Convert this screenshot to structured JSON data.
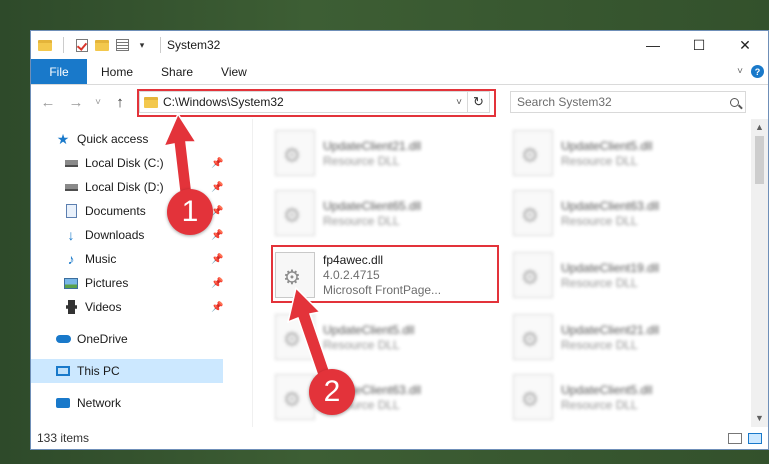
{
  "window": {
    "title": "System32",
    "controls": {
      "minimize": "—",
      "maximize": "☐",
      "close": "✕"
    }
  },
  "ribbon": {
    "file_tab": "File",
    "tabs": [
      "Home",
      "Share",
      "View"
    ]
  },
  "nav": {
    "back": "←",
    "forward": "→",
    "recent": "˅",
    "up": "↑",
    "address": "C:\\Windows\\System32",
    "search_placeholder": "Search System32"
  },
  "sidebar": {
    "items": [
      {
        "label": "Quick access",
        "icon": "star-icon"
      },
      {
        "label": "Local Disk (C:)",
        "icon": "disk-icon",
        "pinned": true
      },
      {
        "label": "Local Disk (D:)",
        "icon": "disk-icon",
        "pinned": true
      },
      {
        "label": "Documents",
        "icon": "documents-icon",
        "pinned": true
      },
      {
        "label": "Downloads",
        "icon": "downloads-icon",
        "pinned": true
      },
      {
        "label": "Music",
        "icon": "music-icon",
        "pinned": true
      },
      {
        "label": "Pictures",
        "icon": "pictures-icon",
        "pinned": true
      },
      {
        "label": "Videos",
        "icon": "videos-icon",
        "pinned": true
      },
      {
        "label": "OneDrive",
        "icon": "cloud-icon"
      },
      {
        "label": "This PC",
        "icon": "computer-icon",
        "selected": true
      },
      {
        "label": "Network",
        "icon": "network-icon"
      }
    ]
  },
  "files": [
    {
      "name": "UpdateClient21.dll",
      "sub": "Resource DLL"
    },
    {
      "name": "UpdateClient5.dll",
      "sub": "Resource DLL"
    },
    {
      "name": "UpdateClient65.dll",
      "sub": "Resource DLL"
    },
    {
      "name": "UpdateClient63.dll",
      "sub": "Resource DLL"
    },
    {
      "name": "fp4awec.dll",
      "version": "4.0.2.4715",
      "sub": "Microsoft FrontPage..."
    },
    {
      "name": "UpdateClient19.dll",
      "sub": "Resource DLL"
    },
    {
      "name": "UpdateClient5.dll",
      "sub": "Resource DLL"
    },
    {
      "name": "UpdateClient21.dll",
      "sub": "Resource DLL"
    },
    {
      "name": "UpdateClient63.dll",
      "sub": "Resource DLL"
    },
    {
      "name": "UpdateClient5.dll",
      "sub": "Resource DLL"
    }
  ],
  "status": {
    "item_count": "133 items"
  },
  "annotations": {
    "step1": "1",
    "step2": "2",
    "color": "#e3333a"
  },
  "colors": {
    "accent": "#1979ca",
    "highlight": "#e3333a",
    "selection": "#cce8ff"
  }
}
